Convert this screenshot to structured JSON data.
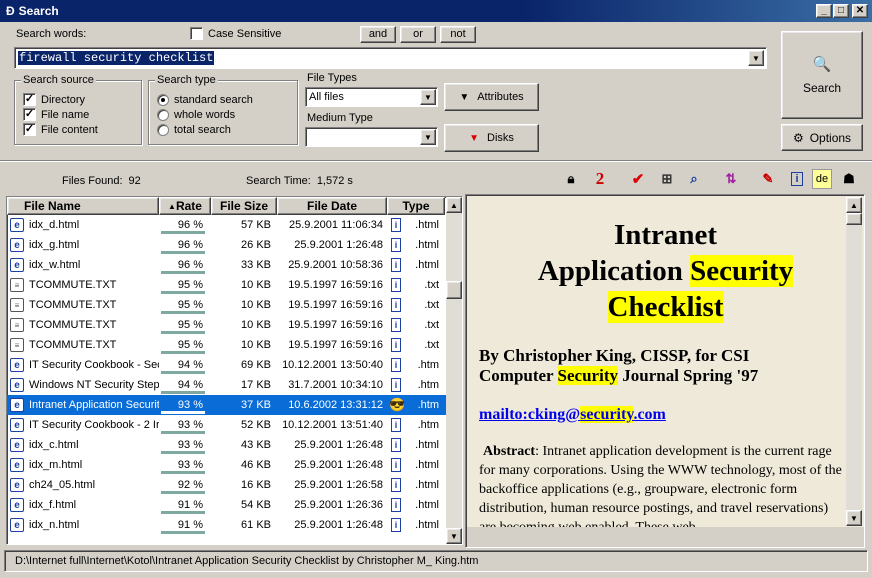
{
  "window": {
    "title": "Search",
    "icon_name": "app-icon"
  },
  "search": {
    "label": "Search words:",
    "value": "firewall security checklist",
    "case_label": "Case Sensitive",
    "case_checked": false,
    "and_label": "and",
    "or_label": "or",
    "not_label": "not",
    "button_label": "Search",
    "options_label": "Options"
  },
  "source": {
    "title": "Search source",
    "items": [
      {
        "label": "Directory",
        "checked": true
      },
      {
        "label": "File name",
        "checked": true
      },
      {
        "label": "File content",
        "checked": true
      }
    ]
  },
  "type": {
    "title": "Search type",
    "items": [
      {
        "label": "standard search",
        "selected": true
      },
      {
        "label": "whole words",
        "selected": false
      },
      {
        "label": "total search",
        "selected": false
      }
    ]
  },
  "filetypes": {
    "label": "File Types",
    "value": "All files",
    "medium_label": "Medium Type",
    "medium_value": "",
    "attributes_label": "Attributes",
    "disks_label": "Disks"
  },
  "status": {
    "files_found_label": "Files Found:",
    "files_found": "92",
    "time_label": "Search Time:",
    "time": "1,572 s"
  },
  "columns": [
    "File Name",
    "Rate",
    "File Size",
    "File Date",
    "Type"
  ],
  "rows": [
    {
      "name": "idx_d.html",
      "rate": "96 %",
      "size": "57 KB",
      "date": "25.9.2001 11:06:34",
      "type": ".html",
      "kind": "web"
    },
    {
      "name": "idx_g.html",
      "rate": "96 %",
      "size": "26 KB",
      "date": "25.9.2001 1:26:48",
      "type": ".html",
      "kind": "web"
    },
    {
      "name": "idx_w.html",
      "rate": "96 %",
      "size": "33 KB",
      "date": "25.9.2001 10:58:36",
      "type": ".html",
      "kind": "web"
    },
    {
      "name": "TCOMMUTE.TXT",
      "rate": "95 %",
      "size": "10 KB",
      "date": "19.5.1997 16:59:16",
      "type": ".txt",
      "kind": "txt"
    },
    {
      "name": "TCOMMUTE.TXT",
      "rate": "95 %",
      "size": "10 KB",
      "date": "19.5.1997 16:59:16",
      "type": ".txt",
      "kind": "txt"
    },
    {
      "name": "TCOMMUTE.TXT",
      "rate": "95 %",
      "size": "10 KB",
      "date": "19.5.1997 16:59:16",
      "type": ".txt",
      "kind": "txt"
    },
    {
      "name": "TCOMMUTE.TXT",
      "rate": "95 %",
      "size": "10 KB",
      "date": "19.5.1997 16:59:16",
      "type": ".txt",
      "kind": "txt"
    },
    {
      "name": "IT Security Cookbook - Sec",
      "rate": "94 %",
      "size": "69 KB",
      "date": "10.12.2001 13:50:40",
      "type": ".htm",
      "kind": "web"
    },
    {
      "name": "Windows NT Security Step",
      "rate": "94 %",
      "size": "17 KB",
      "date": "31.7.2001 10:34:10",
      "type": ".htm",
      "kind": "web"
    },
    {
      "name": "Intranet Application Securit",
      "rate": "93 %",
      "size": "37 KB",
      "date": "10.6.2002 13:31:12",
      "type": ".htm",
      "kind": "web"
    },
    {
      "name": "IT Security Cookbook - 2 Ir",
      "rate": "93 %",
      "size": "52 KB",
      "date": "10.12.2001 13:51:40",
      "type": ".htm",
      "kind": "web"
    },
    {
      "name": "idx_c.html",
      "rate": "93 %",
      "size": "43 KB",
      "date": "25.9.2001 1:26:48",
      "type": ".html",
      "kind": "web"
    },
    {
      "name": "idx_m.html",
      "rate": "93 %",
      "size": "46 KB",
      "date": "25.9.2001 1:26:48",
      "type": ".html",
      "kind": "web"
    },
    {
      "name": "ch24_05.html",
      "rate": "92 %",
      "size": "16 KB",
      "date": "25.9.2001 1:26:58",
      "type": ".html",
      "kind": "web"
    },
    {
      "name": "idx_f.html",
      "rate": "91 %",
      "size": "54 KB",
      "date": "25.9.2001 1:26:36",
      "type": ".html",
      "kind": "web"
    },
    {
      "name": "idx_n.html",
      "rate": "91 %",
      "size": "61 KB",
      "date": "25.9.2001 1:26:48",
      "type": ".html",
      "kind": "web"
    }
  ],
  "selected_row": 9,
  "preview": {
    "title_a": "Intranet",
    "title_b": "Application ",
    "title_hl": "Security",
    "title_c": "Checklist",
    "byline_a": "By Christopher King, CISSP, for CSI",
    "byline_b": "Computer ",
    "byline_hl": "Security",
    "byline_c": " Journal Spring '97",
    "mail_a": "mailto:cking@",
    "mail_hl": "security",
    "mail_b": ".com",
    "abstract_label": "Abstract",
    "abstract_text": ": Intranet application development is the current rage for many corporations. Using the WWW technology, most of the backoffice applications (e.g., groupware, electronic form distribution, human resource postings, and travel reservations) are becoming web enabled. These web"
  },
  "path": "D:\\Internet full\\Internet\\Kotol\\Intranet Application Security Checklist by Christopher M_ King.htm"
}
